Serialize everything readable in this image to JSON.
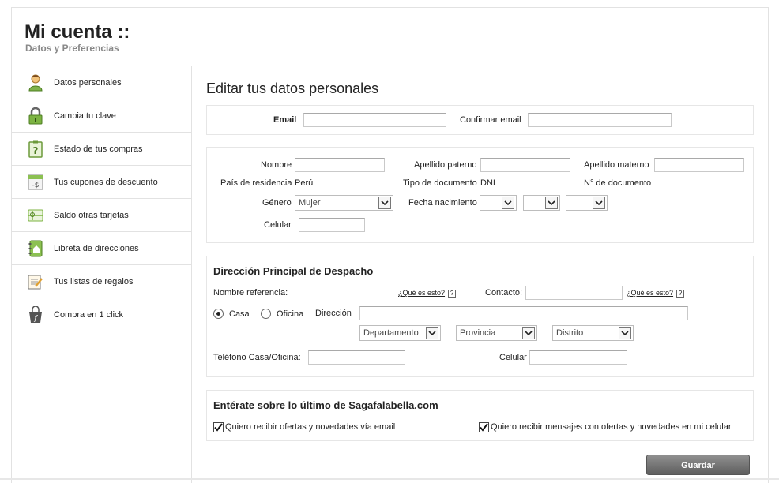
{
  "header": {
    "title": "Mi cuenta ::",
    "subtitle": "Datos y Preferencias"
  },
  "sidebar": {
    "items": [
      {
        "label": "Datos personales",
        "icon": "person-icon"
      },
      {
        "label": "Cambia tu clave",
        "icon": "lock-icon"
      },
      {
        "label": "Estado de tus compras",
        "icon": "clipboard-question-icon"
      },
      {
        "label": "Tus cupones de descuento",
        "icon": "coupon-icon"
      },
      {
        "label": "Saldo otras tarjetas",
        "icon": "gift-card-icon"
      },
      {
        "label": "Libreta de direcciones",
        "icon": "address-book-icon"
      },
      {
        "label": "Tus listas de regalos",
        "icon": "gift-list-icon"
      },
      {
        "label": "Compra en 1 click",
        "icon": "shopping-bag-icon"
      }
    ]
  },
  "main": {
    "title": "Editar tus datos personales",
    "email": {
      "label": "Email",
      "value": "",
      "confirm_label": "Confirmar email",
      "confirm_value": ""
    },
    "personal": {
      "nombre_label": "Nombre",
      "apellido_paterno_label": "Apellido paterno",
      "apellido_materno_label": "Apellido materno",
      "pais_label": "País de residencia",
      "pais_value": "Perú",
      "tipo_doc_label": "Tipo de documento",
      "tipo_doc_value": "DNI",
      "num_doc_label": "N° de documento",
      "genero_label": "Género",
      "genero_value": "Mujer",
      "fecha_label": "Fecha nacimiento",
      "celular_label": "Celular"
    },
    "direccion": {
      "title": "Dirección Principal de Despacho",
      "nombre_ref_label": "Nombre referencia:",
      "help_text": "¿Qué es esto?",
      "help_icon": "?",
      "contacto_label": "Contacto:",
      "casa_label": "Casa",
      "oficina_label": "Oficina",
      "direccion_label": "Dirección",
      "departamento": "Departamento",
      "provincia": "Provincia",
      "distrito": "Distrito",
      "telefono_label": "Teléfono Casa/Oficina:",
      "celular_label": "Celular"
    },
    "news": {
      "title": "Entérate sobre lo último de Sagafalabella.com",
      "email_opt": "Quiero recibir ofertas y novedades vía email",
      "sms_opt": "Quiero recibir mensajes con ofertas y novedades en mi celular"
    },
    "save_label": "Guardar"
  }
}
